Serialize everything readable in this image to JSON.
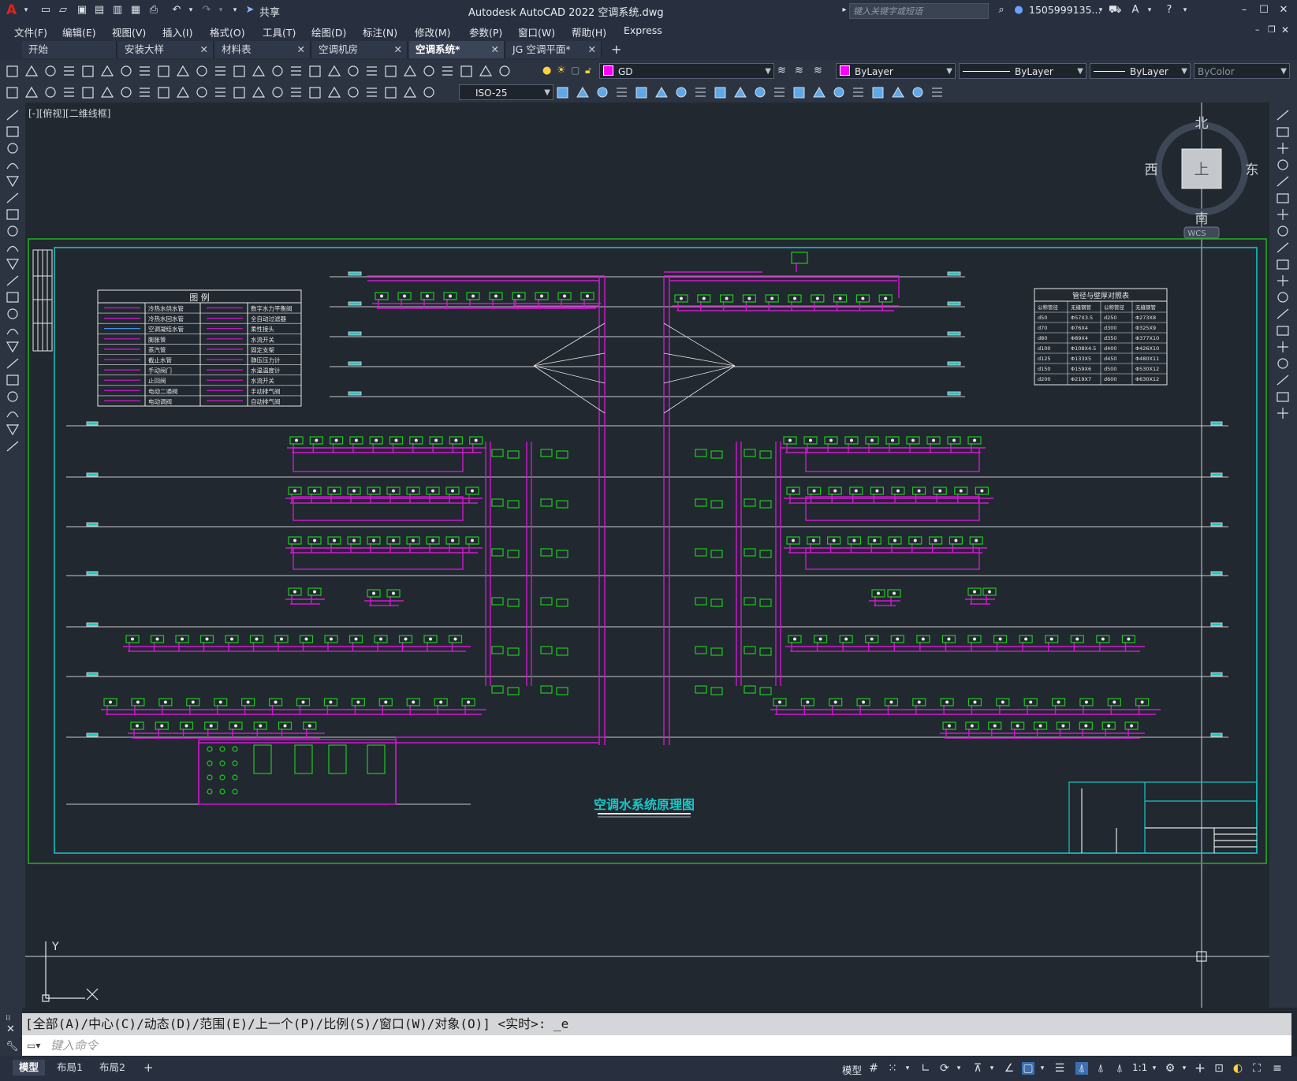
{
  "app": {
    "title": "Autodesk AutoCAD 2022    空调系统.dwg",
    "logo": "A",
    "share_label": "共享",
    "search_placeholder": "键入关键字或短语",
    "user": "1505999135...",
    "window_controls": [
      "minimize-icon",
      "maximize-icon",
      "close-icon"
    ]
  },
  "menu": [
    "文件(F)",
    "编辑(E)",
    "视图(V)",
    "插入(I)",
    "格式(O)",
    "工具(T)",
    "绘图(D)",
    "标注(N)",
    "修改(M)",
    "参数(P)",
    "窗口(W)",
    "帮助(H)",
    "Express"
  ],
  "tabs": [
    {
      "label": "开始",
      "closable": false,
      "active": false
    },
    {
      "label": "安装大样",
      "closable": true,
      "active": false
    },
    {
      "label": "材料表",
      "closable": true,
      "active": false
    },
    {
      "label": "空调机房",
      "closable": true,
      "active": false
    },
    {
      "label": "空调系统*",
      "closable": true,
      "active": true
    },
    {
      "label": "JG 空调平面*",
      "closable": true,
      "active": false
    }
  ],
  "toolbar": {
    "layer": "GD",
    "color": "ByLayer",
    "linetype": "ByLayer",
    "lineweight": "ByLayer",
    "plotstyle": "ByColor",
    "dimstyle": "ISO-25",
    "layer_color": "#ff00ff"
  },
  "viewport": {
    "label": "[-][俯视][二维线框]",
    "compass": {
      "north": "北",
      "south": "南",
      "east": "东",
      "west": "西",
      "top": "上",
      "wcs": "WCS"
    },
    "ucs": {
      "x": "X",
      "y": "Y"
    }
  },
  "drawing": {
    "title": "空调水系统原理图",
    "legend_title": "图  例",
    "legend_rows": [
      [
        "冷热水供水管",
        "数字水力平衡阀"
      ],
      [
        "冷热水回水管",
        "全自动过滤器"
      ],
      [
        "空调凝结水管",
        "柔性接头"
      ],
      [
        "膨胀管",
        "水流开关"
      ],
      [
        "蒸汽管",
        "固定支架"
      ],
      [
        "截止水管",
        "静压压力计"
      ],
      [
        "手动阀门",
        "水温温度计"
      ],
      [
        "止回阀",
        "水流开关"
      ],
      [
        "电动二通阀",
        "手动排气阀"
      ],
      [
        "电动调阀",
        "自动排气阀"
      ]
    ],
    "pipe_table_title": "管径与壁厚对照表",
    "pipe_table_headers": [
      "公称管径",
      "无缝钢管",
      "公称管径",
      "无缝钢管"
    ],
    "pipe_table_rows": [
      [
        "d50",
        "Φ57X3.5",
        "d250",
        "Φ273X8"
      ],
      [
        "d70",
        "Φ76X4",
        "d300",
        "Φ325X9"
      ],
      [
        "d80",
        "Φ89X4",
        "d350",
        "Φ377X10"
      ],
      [
        "d100",
        "Φ108X4.5",
        "d400",
        "Φ426X10"
      ],
      [
        "d125",
        "Φ133X5",
        "d450",
        "Φ480X11"
      ],
      [
        "d150",
        "Φ159X6",
        "d500",
        "Φ530X12"
      ],
      [
        "d200",
        "Φ219X7",
        "d600",
        "Φ630X12"
      ]
    ],
    "colors": {
      "pipe": "#d218d2",
      "equip": "#1ec81e",
      "frame": "#19c8c8",
      "outer": "#1eb41e",
      "text": "#e6e6e6",
      "level": "#c8c8c8"
    }
  },
  "command": {
    "history": "[全部(A)/中心(C)/动态(D)/范围(E)/上一个(P)/比例(S)/窗口(W)/对象(O)] <实时>: _e",
    "placeholder": "键入命令"
  },
  "statusbar": {
    "layouts": [
      "模型",
      "布局1",
      "布局2"
    ],
    "model_label": "模型",
    "scale": "1:1"
  }
}
